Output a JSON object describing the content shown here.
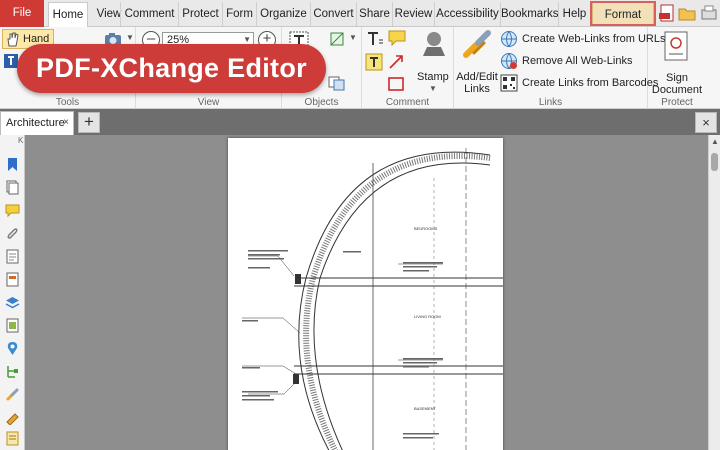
{
  "menu": {
    "tabs": [
      "File",
      "Home",
      "View",
      "Comment",
      "Protect",
      "Form",
      "Organize",
      "Convert",
      "Share",
      "Review",
      "Accessibility",
      "Bookmarks",
      "Help",
      "Format"
    ]
  },
  "ribbon": {
    "tools": {
      "hand_label": "Hand",
      "group_label": "Tools"
    },
    "view": {
      "zoom_value": "25%",
      "group_label": "View"
    },
    "objects": {
      "group_label": "Objects"
    },
    "comment": {
      "stamp_label": "Stamp",
      "group_label": "Comment"
    },
    "links": {
      "add_edit_line1": "Add/Edit",
      "add_edit_line2": "Links",
      "create_web_links": "Create Web-Links from URLs",
      "remove_web_links": "Remove All Web-Links",
      "create_barcode_links": "Create Links from Barcodes",
      "group_label": "Links"
    },
    "protect": {
      "sign_line1": "Sign",
      "sign_line2": "Document",
      "group_label": "Protect"
    }
  },
  "banner": {
    "text": "PDF-XChange Editor"
  },
  "documents": {
    "active_tab": "Architecture",
    "close_glyph": "×",
    "add_glyph": "+"
  },
  "drawing": {
    "rooms": [
      "BEDROOMS",
      "LIVING ROOM",
      "BASEMENT"
    ]
  },
  "colors": {
    "file_tab": "#cf3a34",
    "format_tab": "#f2e1b8",
    "banner": "#cd3c38",
    "workspace": "#8e8e8e"
  }
}
